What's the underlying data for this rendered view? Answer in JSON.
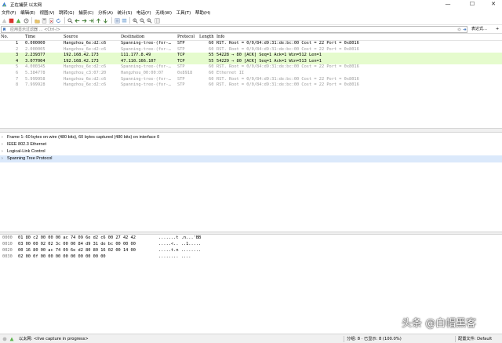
{
  "window": {
    "title": "正在捕获 以太网",
    "controls": [
      "—",
      "☐",
      "✕"
    ]
  },
  "menu": [
    "文件(F)",
    "编辑(E)",
    "视图(V)",
    "跳转(G)",
    "捕获(C)",
    "分析(A)",
    "统计(S)",
    "电话(Y)",
    "无线(W)",
    "工具(T)",
    "帮助(H)"
  ],
  "toolbar": {
    "icons": [
      "shark-fin-start-icon",
      "stop-icon",
      "restart-icon",
      "options-gear-icon",
      "open-file-icon",
      "save-file-icon",
      "close-file-icon",
      "reload-icon",
      "find-icon",
      "back-arrow-icon",
      "forward-arrow-icon",
      "goto-packet-icon",
      "first-packet-icon",
      "last-packet-icon",
      "autoscroll-icon",
      "colorize-icon",
      "zoom-in-icon",
      "zoom-out-icon",
      "zoom-reset-icon",
      "resize-columns-icon"
    ]
  },
  "filter": {
    "placeholder": "应用显示过滤器 … <Ctrl-/>",
    "expression_label": "表达式…",
    "expression_plus": "+"
  },
  "columns": [
    "No.",
    "Time",
    "Source",
    "Destination",
    "Protocol",
    "Length",
    "Info"
  ],
  "packets": [
    {
      "no": "1",
      "time": "0.000000",
      "source": "Hangzhou_6e:d2:c6",
      "destination": "Spanning-tree-(for-…",
      "protocol": "STP",
      "length": "60",
      "info": "RST. Root = 0/0/84:d9:31:de:bc:00  Cost = 22  Port = 0x8016",
      "style": "stp1"
    },
    {
      "no": "2",
      "time": "2.000005",
      "source": "Hangzhou_6e:d2:c6",
      "destination": "Spanning-tree-(for-…",
      "protocol": "STP",
      "length": "60",
      "info": "RST. Root = 0/0/84:d9:31:de:bc:00  Cost = 22  Port = 0x8016",
      "style": "grey"
    },
    {
      "no": "3",
      "time": "2.239377",
      "source": "192.168.42.173",
      "destination": "111.177.8.49",
      "protocol": "TCP",
      "length": "55",
      "info": "54228 → 80 [ACK] Seq=1 Ack=1 Win=512 Len=1",
      "style": "tcp"
    },
    {
      "no": "4",
      "time": "3.077004",
      "source": "192.168.42.173",
      "destination": "47.110.166.107",
      "protocol": "TCP",
      "length": "55",
      "info": "54229 → 80 [ACK] Seq=1 Ack=1 Win=513 Len=1",
      "style": "tcp"
    },
    {
      "no": "5",
      "time": "4.000345",
      "source": "Hangzhou_6e:d2:c6",
      "destination": "Spanning-tree-(for-…",
      "protocol": "STP",
      "length": "60",
      "info": "RST. Root = 0/0/84:d9:31:de:bc:00  Cost = 22  Port = 0x8016",
      "style": "grey"
    },
    {
      "no": "6",
      "time": "5.384778",
      "source": "Hangzhou_c3:07:20",
      "destination": "Hangzhou_00:00:07",
      "protocol": "0x8918",
      "length": "60",
      "info": "Ethernet II",
      "style": "grey"
    },
    {
      "no": "7",
      "time": "5.999958",
      "source": "Hangzhou_6e:d2:c6",
      "destination": "Spanning-tree-(for-…",
      "protocol": "STP",
      "length": "60",
      "info": "RST. Root = 0/0/84:d9:31:de:bc:00  Cost = 22  Port = 0x8016",
      "style": "grey"
    },
    {
      "no": "8",
      "time": "7.999928",
      "source": "Hangzhou_6e:d2:c6",
      "destination": "Spanning-tree-(for-…",
      "protocol": "STP",
      "length": "60",
      "info": "RST. Root = 0/0/84:d9:31:de:bc:00  Cost = 22  Port = 0x8016",
      "style": "grey"
    }
  ],
  "details": [
    {
      "arrow": "›",
      "text": "Frame 1: 60 bytes on wire (480 bits), 60 bytes captured (480 bits) on interface 0",
      "selected": false
    },
    {
      "arrow": "›",
      "text": "IEEE 802.3 Ethernet",
      "selected": false
    },
    {
      "arrow": "›",
      "text": "Logical-Link Control",
      "selected": false
    },
    {
      "arrow": "›",
      "text": "Spanning Tree Protocol",
      "selected": true
    }
  ],
  "bytes": [
    {
      "offset": "0000",
      "hex": "01 80 c2 00 00 00 ac 74  09 6e d2 c6 00 27 42 42",
      "ascii": ".......t .n...'BB"
    },
    {
      "offset": "0010",
      "hex": "03 00 00 02 02 3c 00 00  84 d9 31 de bc 00 00 00",
      "ascii": ".....<.. ..1....."
    },
    {
      "offset": "0020",
      "hex": "00 16 80 00 ac 74 09 6e  d2 80 80 16 02 00 14 00",
      "ascii": ".....t.n ........"
    },
    {
      "offset": "0030",
      "hex": "02 00 0f 00 00 00 00 00  00 00 00 00",
      "ascii": "........ ...."
    }
  ],
  "status": {
    "interface": "以太网: <live capture in progress>",
    "packets": "分组: 8 · 已显示: 8 (100.0%)",
    "profile": "配置文件: Default"
  },
  "watermark": "头条 @白帽黑客",
  "colors": {
    "tcp_row": "#e5fbcd",
    "selected_detail": "#dbe9fb",
    "grey_text": "#9b9b9b"
  }
}
